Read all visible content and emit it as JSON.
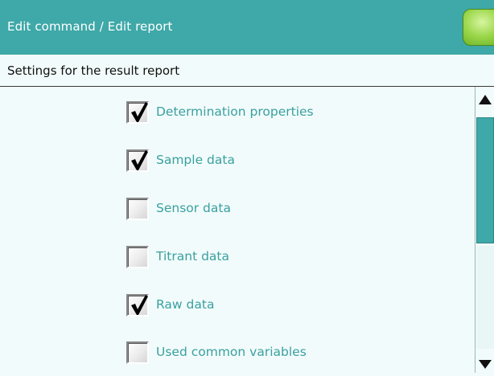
{
  "header": {
    "title": "Edit command / Edit report",
    "action_button_color": "#8fd03a"
  },
  "subheader": {
    "text": "Settings for the result report"
  },
  "options": [
    {
      "label": "Determination properties",
      "checked": true
    },
    {
      "label": "Sample data",
      "checked": true
    },
    {
      "label": "Sensor data",
      "checked": false
    },
    {
      "label": "Titrant data",
      "checked": false
    },
    {
      "label": "Raw data",
      "checked": true
    },
    {
      "label": "Used common variables",
      "checked": false
    }
  ],
  "colors": {
    "accent": "#3fa8a8",
    "background": "#f2fbfb",
    "option_text": "#3aa0a0"
  }
}
